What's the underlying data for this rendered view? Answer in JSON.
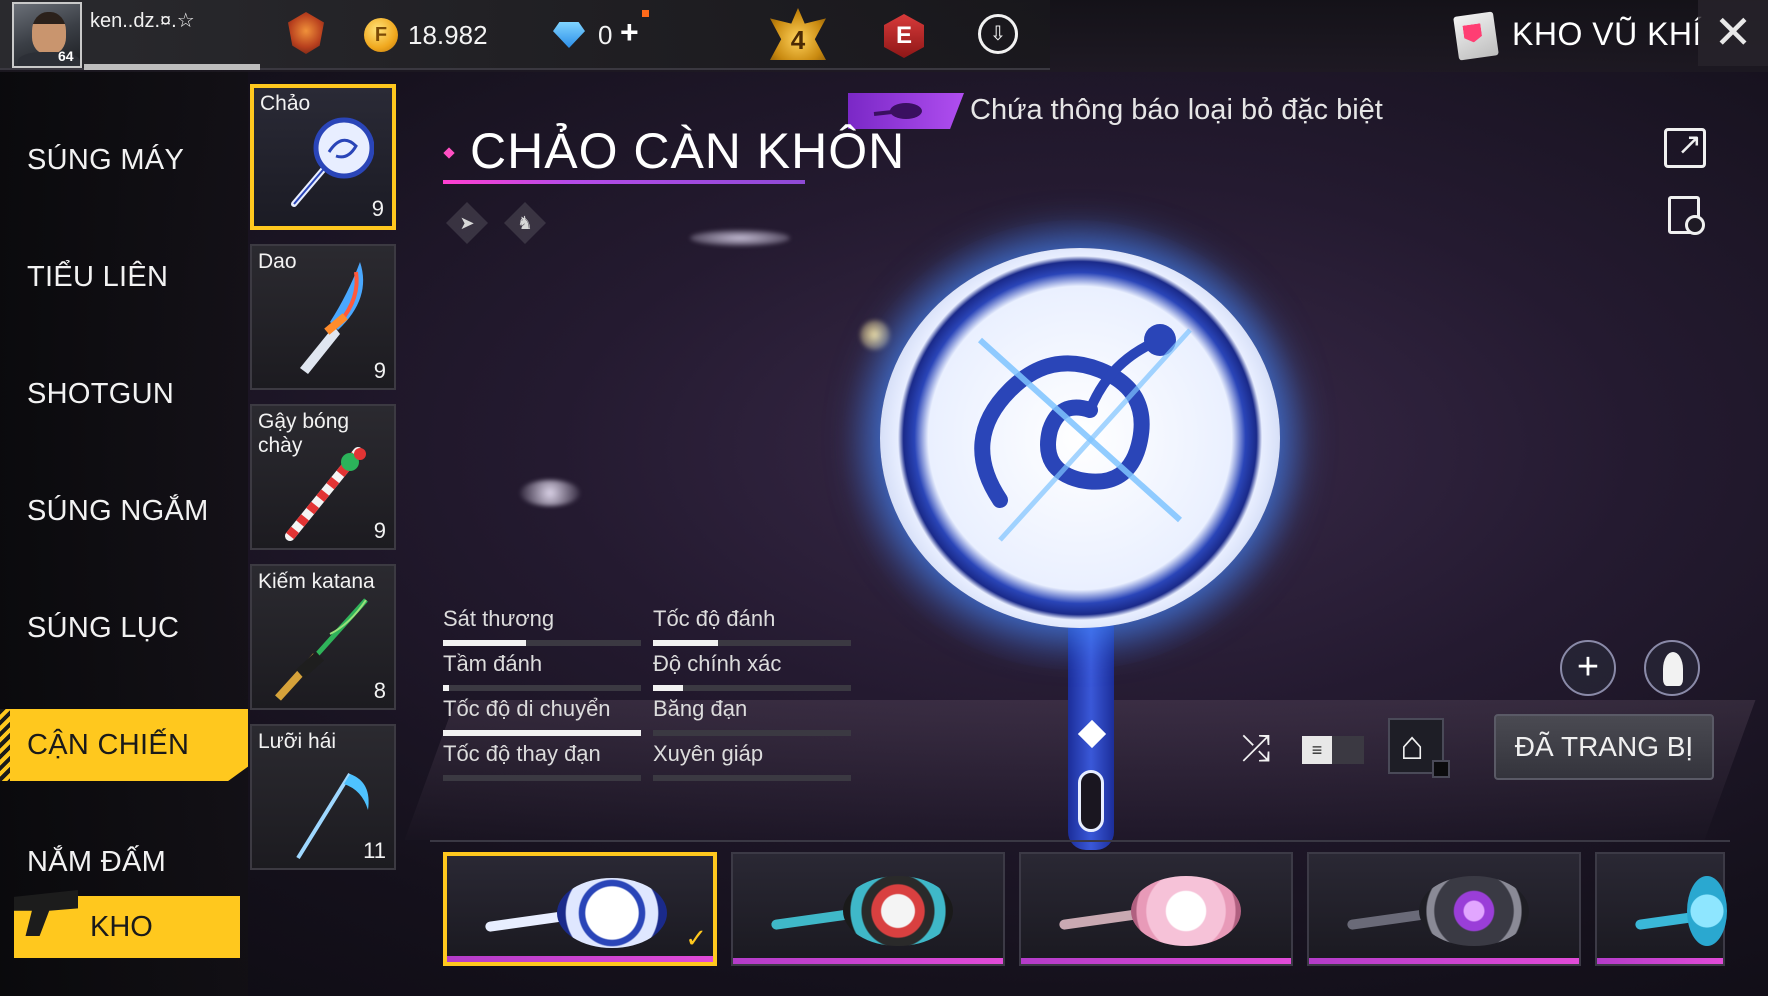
{
  "top_bar": {
    "player_name": "ken..dz.¤.☆",
    "player_level": "64",
    "gold_value": "18.982",
    "gold_icon_text": "F",
    "diamond_value": "0",
    "plus_label": "+",
    "elite_pass_level": "4",
    "e_badge_text": "E",
    "vault_title": "KHO VŨ KHÍ",
    "close_label": "✕"
  },
  "categories": [
    {
      "label": "SÚNG MÁY"
    },
    {
      "label": "TIỂU LIÊN"
    },
    {
      "label": "SHOTGUN"
    },
    {
      "label": "SÚNG NGẮM"
    },
    {
      "label": "SÚNG LỤC"
    },
    {
      "label": "CẬN CHIẾN"
    },
    {
      "label": "NẮM ĐẤM"
    }
  ],
  "active_category": "CẬN CHIẾN",
  "gun_vault_label": "KHO SÚNG",
  "weapons": [
    {
      "name": "Chảo",
      "count": "9"
    },
    {
      "name": "Dao",
      "count": "9"
    },
    {
      "name": "Gậy bóng chày",
      "count": "9"
    },
    {
      "name": "Kiếm katana",
      "count": "8"
    },
    {
      "name": "Lưỡi hái",
      "count": "11"
    }
  ],
  "detail": {
    "notice_text": "Chứa thông báo loại bỏ đặc biệt",
    "weapon_title": "CHẢO CÀN KHÔN",
    "equipped_label": "ĐÃ TRANG BỊ",
    "toggle_label": "≡",
    "zoom_label": "+"
  },
  "stats": [
    {
      "label": "Sát thương",
      "value": 0.42
    },
    {
      "label": "Tốc độ đánh",
      "value": 0.33
    },
    {
      "label": "Tầm đánh",
      "value": 0.03
    },
    {
      "label": "Độ chính xác",
      "value": 0.15
    },
    {
      "label": "Tốc độ di chuyển",
      "value": 1.0
    },
    {
      "label": "Băng đạn",
      "value": 0
    },
    {
      "label": "Tốc độ thay đạn",
      "value": 0
    },
    {
      "label": "Xuyên giáp",
      "value": 0
    }
  ],
  "skins_selected_check": "✓",
  "colors": {
    "accent_yellow": "#ffc81e",
    "title_underline": "#ff3fd0",
    "rarity_purple": "#b43cc9",
    "pan_blue": "#1c2e9a"
  }
}
